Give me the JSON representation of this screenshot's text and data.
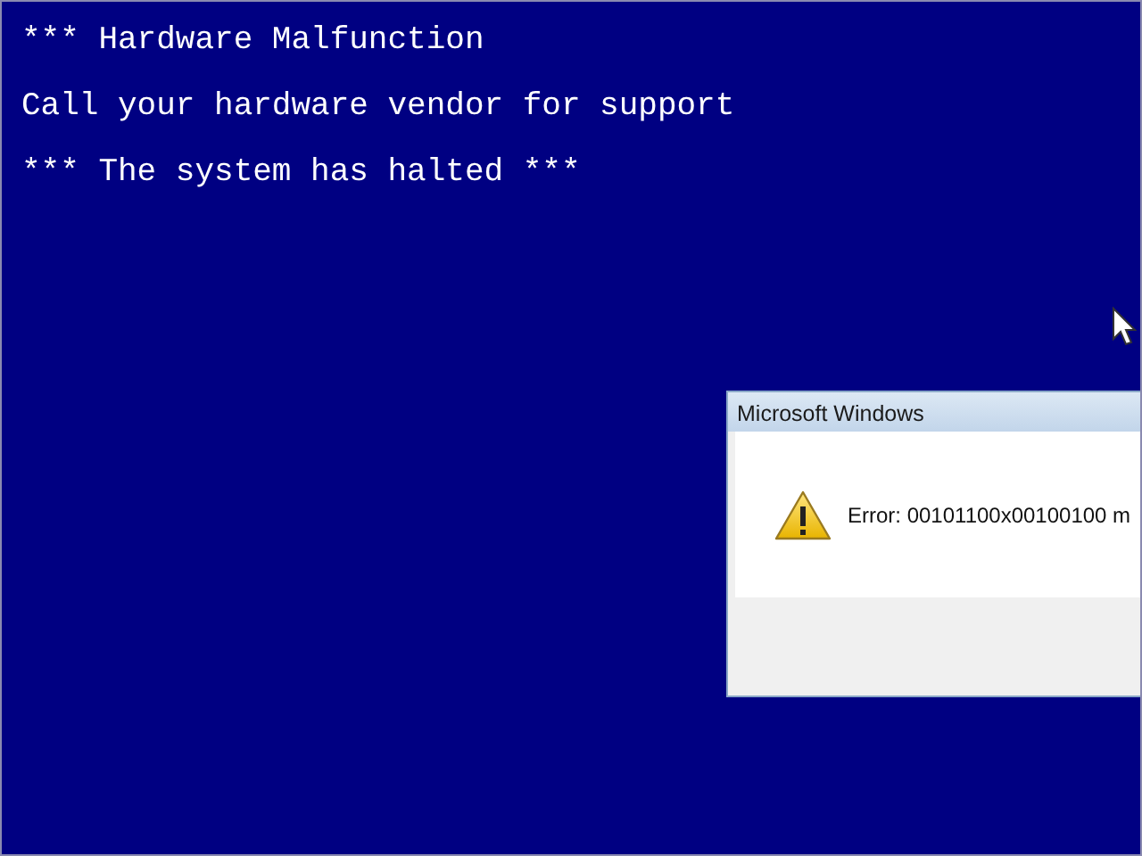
{
  "console_lines": [
    "*** Hardware Malfunction",
    "Call your hardware vendor for support",
    "*** The system has halted ***"
  ],
  "dialog": {
    "title": "Microsoft Windows",
    "message": "Error: 00101100x00100100 m"
  }
}
